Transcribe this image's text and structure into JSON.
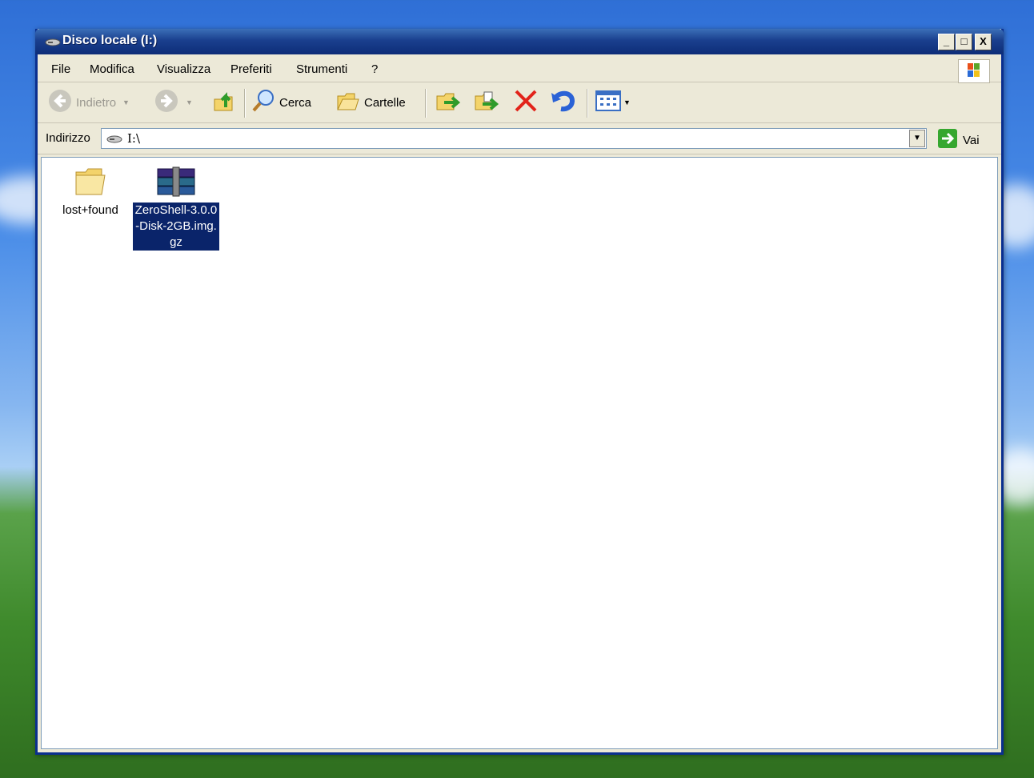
{
  "window": {
    "title": "Disco locale (I:)",
    "buttons": {
      "minimize": "_",
      "maximize": "□",
      "close": "X"
    }
  },
  "menu": [
    "File",
    "Modifica",
    "Visualizza",
    "Preferiti",
    "Strumenti",
    "?"
  ],
  "toolbar": {
    "back_label": "Indietro",
    "search_label": "Cerca",
    "folders_label": "Cartelle"
  },
  "address": {
    "label": "Indirizzo",
    "value": "I:\\",
    "go_label": "Vai"
  },
  "files": [
    {
      "name": "lost+found",
      "type": "folder",
      "selected": false
    },
    {
      "name": "ZeroShell-3.0.0-Disk-2GB.img.gz",
      "type": "winrar-archive",
      "selected": true
    }
  ],
  "colors": {
    "titlebar": "#0d2d78",
    "selection": "#0a246a",
    "window_bg": "#ece9d8"
  }
}
